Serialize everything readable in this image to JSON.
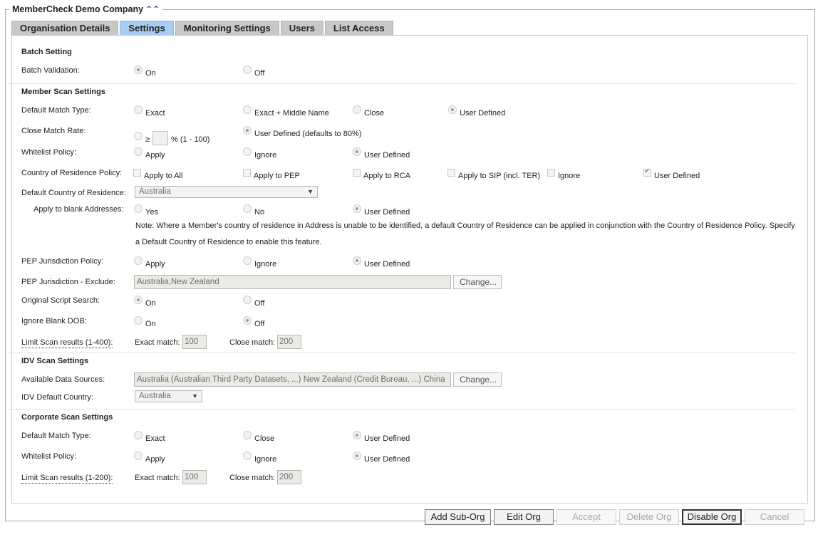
{
  "header": {
    "title": "MemberCheck Demo Company",
    "collapse_icon": "double-chevron-up-icon"
  },
  "tabs": [
    {
      "label": "Organisation Details",
      "active": false
    },
    {
      "label": "Settings",
      "active": true
    },
    {
      "label": "Monitoring Settings",
      "active": false
    },
    {
      "label": "Users",
      "active": false
    },
    {
      "label": "List Access",
      "active": false
    }
  ],
  "batch": {
    "title": "Batch Setting",
    "validation": {
      "label": "Batch Validation:",
      "options": [
        "On",
        "Off"
      ],
      "selected": "On"
    }
  },
  "member": {
    "title": "Member Scan Settings",
    "default_match_type": {
      "label": "Default Match Type:",
      "options": [
        "Exact",
        "Exact + Middle Name",
        "Close",
        "User Defined"
      ],
      "selected": "User Defined"
    },
    "close_match_rate": {
      "label": "Close Match Rate:",
      "prefix": "≥",
      "suffix": "% (1 - 100)",
      "value": "",
      "user_defined": "User Defined (defaults to 80%)",
      "selected": "User Defined"
    },
    "whitelist": {
      "label": "Whitelist Policy:",
      "options": [
        "Apply",
        "Ignore",
        "User Defined"
      ],
      "selected": "User Defined"
    },
    "residence_policy": {
      "label": "Country of Residence Policy:",
      "options": [
        "Apply to All",
        "Apply to PEP",
        "Apply to RCA",
        "Apply to SIP (incl. TER)",
        "Ignore",
        "User Defined"
      ],
      "checked": [
        "User Defined"
      ]
    },
    "default_country": {
      "label": "Default Country of Residence:",
      "value": "Australia"
    },
    "blank_addresses": {
      "label": "Apply to blank Addresses:",
      "options": [
        "Yes",
        "No",
        "User Defined"
      ],
      "selected": "User Defined"
    },
    "note_line1": "Note: Where a Member's country of residence in Address is unable to be identified, a default Country of Residence can be applied in conjunction with the Country of Residence Policy. Specify",
    "note_line2": "a Default Country of Residence to enable this feature.",
    "pep_policy": {
      "label": "PEP Jurisdiction Policy:",
      "options": [
        "Apply",
        "Ignore",
        "User Defined"
      ],
      "selected": "User Defined"
    },
    "pep_exclude": {
      "label": "PEP Jurisdiction - Exclude:",
      "value": "Australia,New Zealand",
      "button": "Change..."
    },
    "original_script": {
      "label": "Original Script Search:",
      "options": [
        "On",
        "Off"
      ],
      "selected": "On"
    },
    "ignore_blank_dob": {
      "label": "Ignore Blank DOB:",
      "options": [
        "On",
        "Off"
      ],
      "selected": "Off"
    },
    "limit": {
      "label": "Limit Scan results (1-400):",
      "exact_label": "Exact match:",
      "exact": "100",
      "close_label": "Close match:",
      "close": "200"
    }
  },
  "idv": {
    "title": "IDV Scan Settings",
    "data_sources": {
      "label": "Available Data Sources:",
      "value": "Australia (Australian Third Party Datasets, ...) New Zealand (Credit Bureau, ...) China",
      "button": "Change..."
    },
    "default_country": {
      "label": "IDV Default Country:",
      "value": "Australia"
    }
  },
  "corporate": {
    "title": "Corporate Scan Settings",
    "default_match_type": {
      "label": "Default Match Type:",
      "options": [
        "Exact",
        "Close",
        "User Defined"
      ],
      "selected": "User Defined"
    },
    "whitelist": {
      "label": "Whitelist Policy:",
      "options": [
        "Apply",
        "Ignore",
        "User Defined"
      ],
      "selected": "User Defined"
    },
    "limit": {
      "label": "Limit Scan results (1-200):",
      "exact_label": "Exact match:",
      "exact": "100",
      "close_label": "Close match:",
      "close": "200"
    }
  },
  "footer": {
    "buttons": [
      {
        "label": "Add Sub-Org",
        "enabled": true
      },
      {
        "label": "Edit Org",
        "enabled": true
      },
      {
        "label": "Accept",
        "enabled": false
      },
      {
        "label": "Delete Org",
        "enabled": false
      },
      {
        "label": "Disable Org",
        "enabled": true
      },
      {
        "label": "Cancel",
        "enabled": false
      }
    ]
  }
}
